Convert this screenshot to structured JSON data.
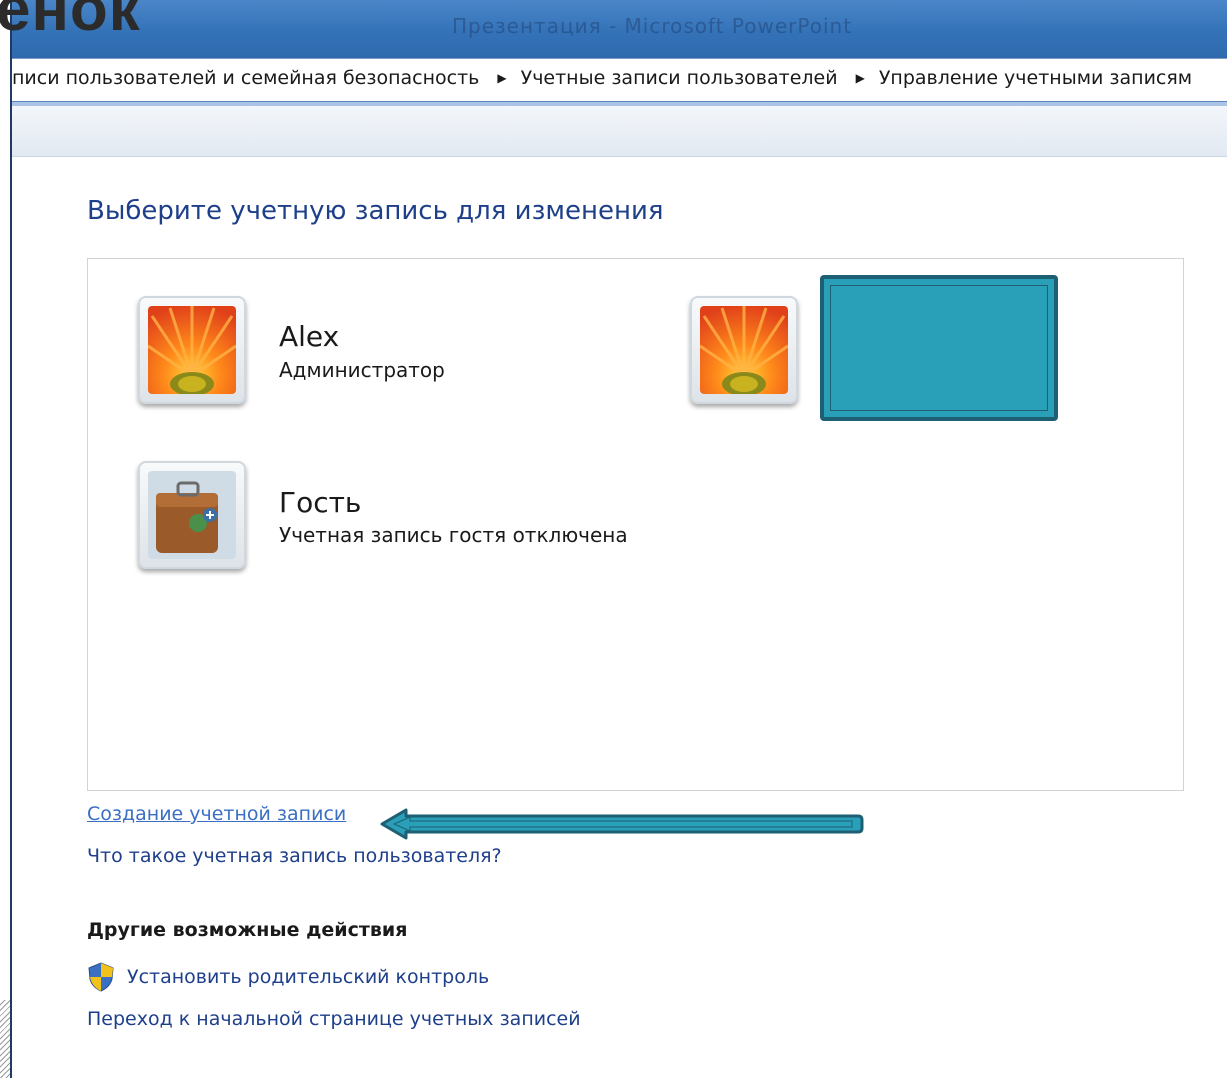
{
  "slide": {
    "heading_fragment": "енок"
  },
  "window": {
    "title": "Презентация - Microsoft PowerPoint"
  },
  "breadcrumb": {
    "items": [
      "писи пользователей и семейная безопасность",
      "Учетные записи пользователей",
      "Управление учетными записям"
    ]
  },
  "main": {
    "title": "Выберите учетную запись для изменения",
    "accounts": [
      {
        "name": "Alex",
        "description": "Администратор",
        "picture": "flower-avatar"
      },
      {
        "name": "",
        "description": "",
        "picture": "flower-avatar"
      },
      {
        "name": "Гость",
        "description": "Учетная запись гостя отключена",
        "picture": "suitcase-avatar"
      }
    ],
    "links": {
      "create_account": "Создание учетной записи",
      "what_is_account": "Что такое учетная запись пользователя?"
    },
    "other_actions": {
      "heading": "Другие возможные действия",
      "parental_control": "Установить родительский контроль",
      "home_page": "Переход к начальной странице учетных записей"
    }
  },
  "annotation": {
    "redaction_color": "#2a9fb8",
    "arrow_color": "#2a9fb8"
  }
}
